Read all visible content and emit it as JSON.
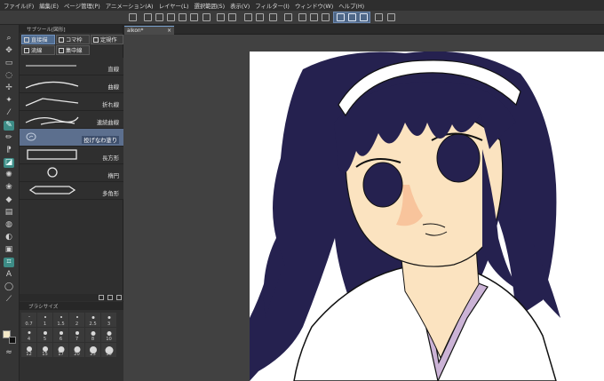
{
  "menu": [
    "ファイル(F)",
    "編集(E)",
    "ページ管理(P)",
    "アニメーション(A)",
    "レイヤー(L)",
    "選択範囲(S)",
    "表示(V)",
    "フィルター(I)",
    "ウィンドウ(W)",
    "ヘルプ(H)"
  ],
  "subtool_panel": {
    "title": "サブツール[図形]",
    "groups": [
      "直接描",
      "コマ枠",
      "定規作",
      "流線",
      "集中線"
    ],
    "items": [
      "直線",
      "曲線",
      "折れ線",
      "連続曲線",
      "投げなわ塗り",
      "長方形",
      "楕円",
      "多角形"
    ],
    "selected_index": 4
  },
  "brush_panel": {
    "title": "ブラシサイズ",
    "sizes": [
      "0.7",
      "1",
      "1.5",
      "2",
      "2.5",
      "3",
      "4",
      "5",
      "6",
      "7",
      "8",
      "10",
      "12",
      "15",
      "17",
      "20",
      "25",
      "30"
    ]
  },
  "document": {
    "tab_label": "aikon*",
    "close_glyph": "×"
  },
  "colors": {
    "accent": "#506c90",
    "active_tool": "#3d8c86",
    "hair": "#25214f",
    "skin": "#fbe3c0",
    "collar": "#cbb3d6"
  }
}
